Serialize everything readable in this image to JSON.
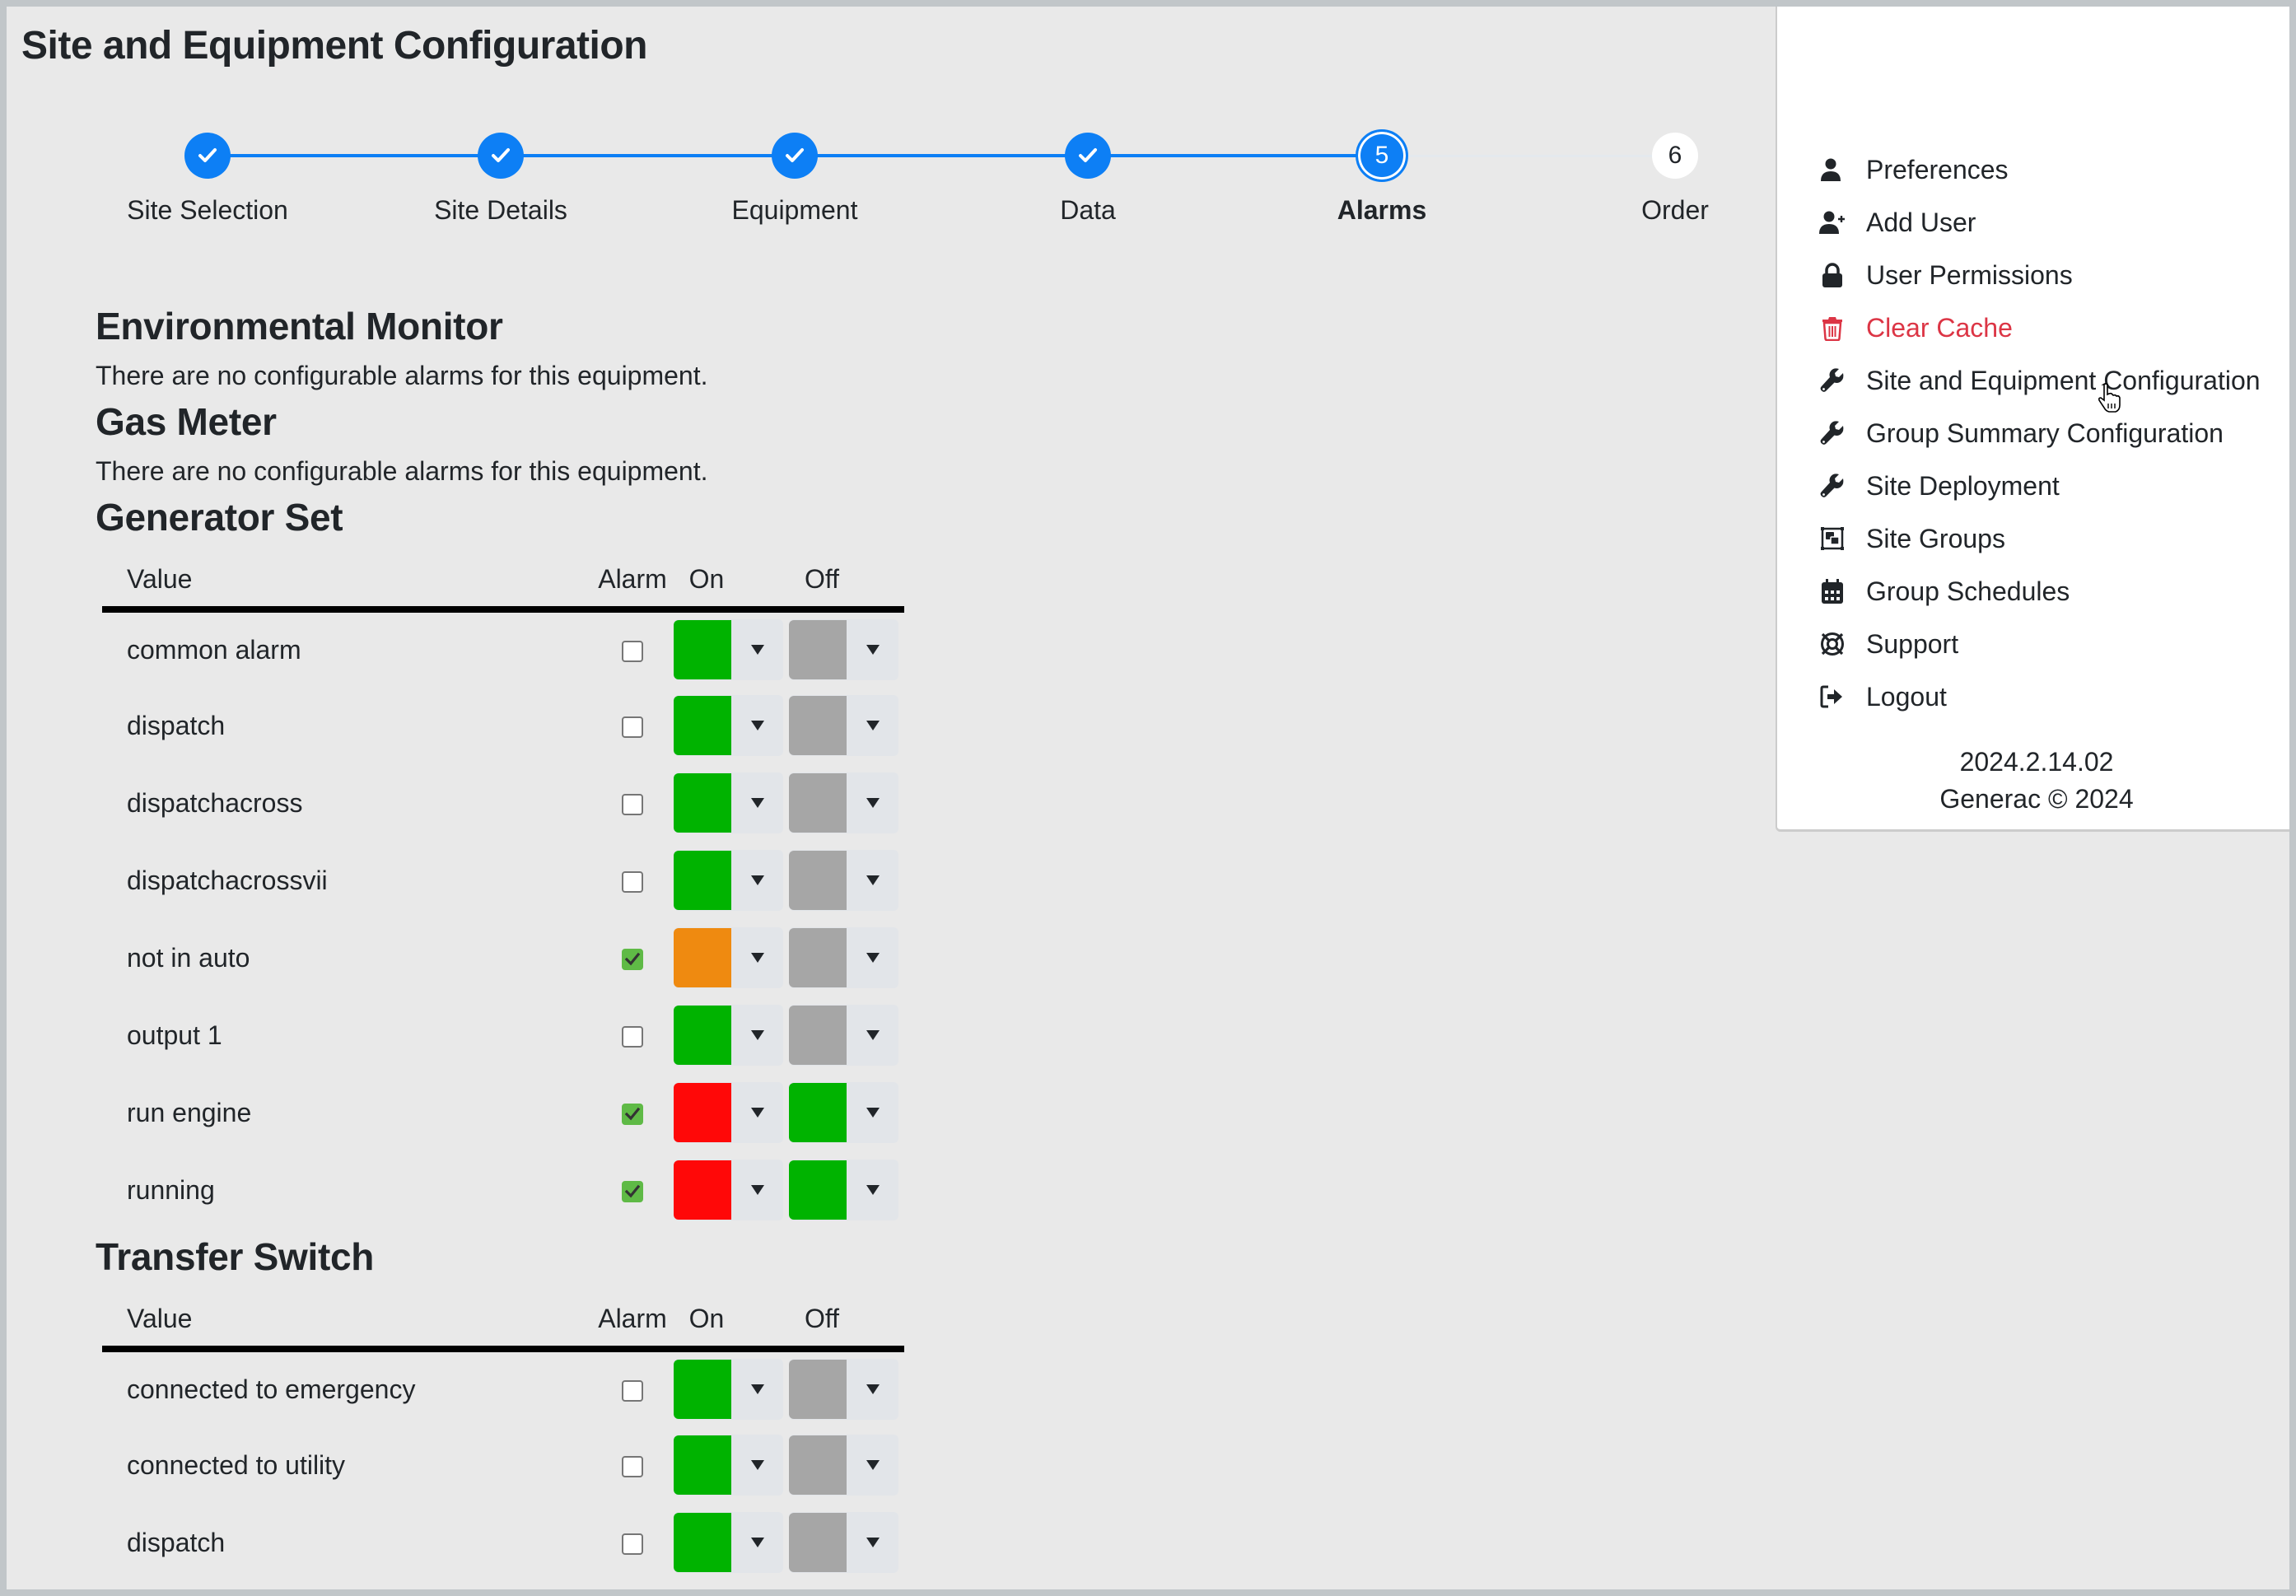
{
  "page": {
    "title": "Site and Equipment Configuration"
  },
  "stepper": {
    "steps": [
      {
        "number": "1",
        "label": "Site Selection",
        "state": "complete"
      },
      {
        "number": "2",
        "label": "Site Details",
        "state": "complete"
      },
      {
        "number": "3",
        "label": "Equipment",
        "state": "complete"
      },
      {
        "number": "4",
        "label": "Data",
        "state": "complete"
      },
      {
        "number": "5",
        "label": "Alarms",
        "state": "active"
      },
      {
        "number": "6",
        "label": "Order",
        "state": "pending"
      }
    ]
  },
  "sections": [
    {
      "title": "Environmental Monitor",
      "message": "There are no configurable alarms for this equipment."
    },
    {
      "title": "Gas Meter",
      "message": "There are no configurable alarms for this equipment."
    },
    {
      "title": "Generator Set",
      "table": {
        "headers": {
          "value": "Value",
          "alarm": "Alarm",
          "on": "On",
          "off": "Off"
        },
        "rows": [
          {
            "value": "common alarm",
            "alarm": false,
            "on_color": "#00b300",
            "off_color": "#a6a6a6"
          },
          {
            "value": "dispatch",
            "alarm": false,
            "on_color": "#00b300",
            "off_color": "#a6a6a6"
          },
          {
            "value": "dispatchacross",
            "alarm": false,
            "on_color": "#00b300",
            "off_color": "#a6a6a6"
          },
          {
            "value": "dispatchacrossvii",
            "alarm": false,
            "on_color": "#00b300",
            "off_color": "#a6a6a6"
          },
          {
            "value": "not in auto",
            "alarm": true,
            "on_color": "#ef8a10",
            "off_color": "#a6a6a6"
          },
          {
            "value": "output 1",
            "alarm": false,
            "on_color": "#00b300",
            "off_color": "#a6a6a6"
          },
          {
            "value": "run engine",
            "alarm": true,
            "on_color": "#ff0808",
            "off_color": "#00b300"
          },
          {
            "value": "running",
            "alarm": true,
            "on_color": "#ff0808",
            "off_color": "#00b300"
          }
        ]
      }
    },
    {
      "title": "Transfer Switch",
      "table": {
        "headers": {
          "value": "Value",
          "alarm": "Alarm",
          "on": "On",
          "off": "Off"
        },
        "rows": [
          {
            "value": "connected to emergency",
            "alarm": false,
            "on_color": "#00b300",
            "off_color": "#a6a6a6"
          },
          {
            "value": "connected to utility",
            "alarm": false,
            "on_color": "#00b300",
            "off_color": "#a6a6a6"
          },
          {
            "value": "dispatch",
            "alarm": false,
            "on_color": "#00b300",
            "off_color": "#a6a6a6"
          }
        ]
      }
    }
  ],
  "menu": {
    "items": [
      {
        "label": "Preferences",
        "icon": "user-icon"
      },
      {
        "label": "Add User",
        "icon": "user-plus-icon"
      },
      {
        "label": "User Permissions",
        "icon": "lock-icon"
      },
      {
        "label": "Clear Cache",
        "icon": "trash-icon",
        "danger": true
      },
      {
        "label": "Site and Equipment Configuration",
        "icon": "wrench-icon"
      },
      {
        "label": "Group Summary Configuration",
        "icon": "wrench-icon"
      },
      {
        "label": "Site Deployment",
        "icon": "wrench-icon"
      },
      {
        "label": "Site Groups",
        "icon": "object-group-icon"
      },
      {
        "label": "Group Schedules",
        "icon": "calendar-icon"
      },
      {
        "label": "Support",
        "icon": "life-ring-icon"
      },
      {
        "label": "Logout",
        "icon": "sign-out-icon"
      }
    ],
    "version": "2024.2.14.02",
    "copyright": "Generac © 2024"
  },
  "colors": {
    "accent": "#0d7ff5",
    "danger": "#dc3545",
    "checkbox_checked": "#5fba46",
    "background": "#e9e9e9"
  }
}
